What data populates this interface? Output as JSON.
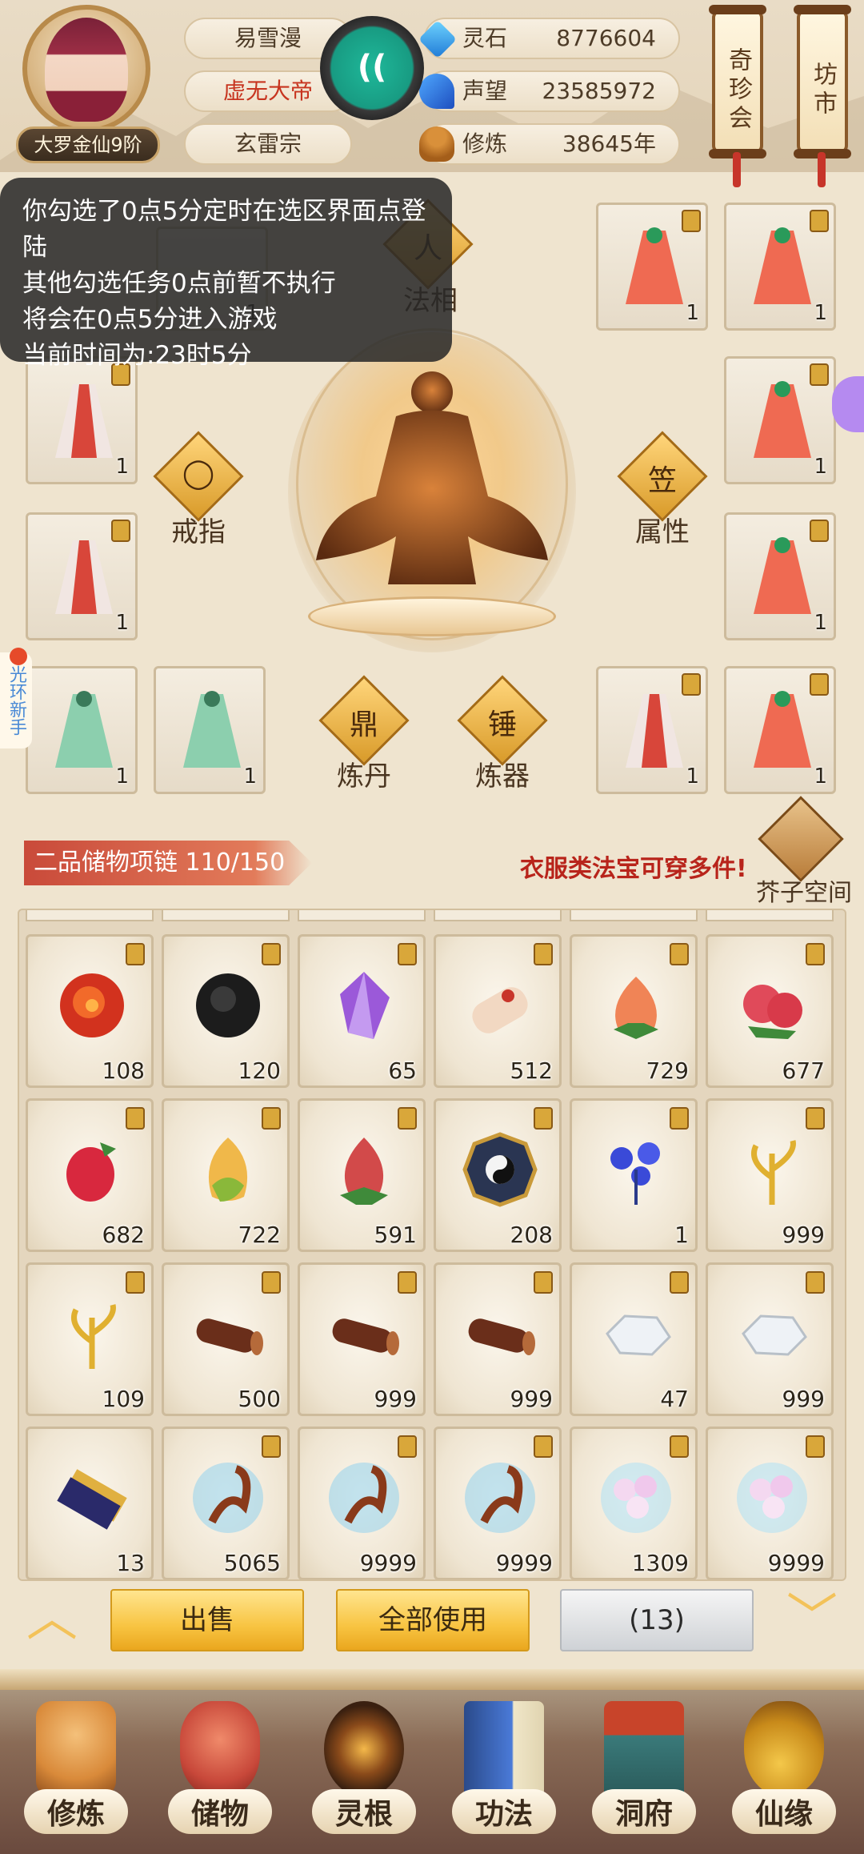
{
  "header": {
    "rank_label": "大罗金仙9阶",
    "name": "易雪漫",
    "title": "虚无大帝",
    "sect": "玄雷宗",
    "resources": [
      {
        "label": "灵石",
        "value": "8776604",
        "icon": "spirit-stone-icon"
      },
      {
        "label": "声望",
        "value": "23585972",
        "icon": "reputation-icon"
      },
      {
        "label": "修炼",
        "value": "38645年",
        "icon": "cultivation-icon"
      }
    ],
    "scroll_buttons": [
      {
        "label": "奇珍会"
      },
      {
        "label": "坊市"
      }
    ]
  },
  "notice": {
    "lines": [
      "你勾选了0点5分定时在选区界面点登陆",
      "其他勾选任务0点前暂不执行",
      "将会在0点5分进入游戏",
      "当前时间为:23时5分"
    ]
  },
  "equipment": {
    "slot_buttons": [
      {
        "label": "法相",
        "glyph": "人"
      },
      {
        "label": "戒指",
        "glyph": "◯"
      },
      {
        "label": "属性",
        "glyph": "笠"
      },
      {
        "label": "炼丹",
        "glyph": "鼎"
      },
      {
        "label": "炼器",
        "glyph": "锤"
      }
    ],
    "slots": [
      {
        "count": "1",
        "robe": "red"
      },
      {
        "count": "1",
        "robe": "red"
      },
      {
        "count": "1",
        "robe": "red"
      },
      {
        "count": "1",
        "robe": "white-red"
      },
      {
        "count": "1",
        "robe": "red"
      },
      {
        "count": "1",
        "robe": "white-red"
      },
      {
        "count": "1",
        "robe": "red"
      },
      {
        "count": "1",
        "robe": "green"
      },
      {
        "count": "1",
        "robe": "green"
      },
      {
        "count": "1",
        "robe": "white-red"
      },
      {
        "count": "1",
        "robe": "red"
      }
    ],
    "hidden_slot_count": "1",
    "side_tab": "光环新手"
  },
  "storage": {
    "title": "二品储物项链 110/150",
    "tip": "衣服类法宝可穿多件!",
    "mustard_label": "芥子空间"
  },
  "items": [
    {
      "qty": "108",
      "art": "red-orb-icon"
    },
    {
      "qty": "120",
      "art": "black-orb-icon"
    },
    {
      "qty": "65",
      "art": "purple-crystal-icon"
    },
    {
      "qty": "512",
      "art": "scroll-icon"
    },
    {
      "qty": "729",
      "art": "peach-icon"
    },
    {
      "qty": "677",
      "art": "berries-icon"
    },
    {
      "qty": "682",
      "art": "raspberry-icon"
    },
    {
      "qty": "722",
      "art": "lotus-fruit-icon"
    },
    {
      "qty": "591",
      "art": "red-bulb-icon"
    },
    {
      "qty": "208",
      "art": "bagua-compass-icon"
    },
    {
      "qty": "1",
      "art": "blue-flower-icon"
    },
    {
      "qty": "999",
      "art": "golden-herb-icon"
    },
    {
      "qty": "109",
      "art": "golden-herb-icon"
    },
    {
      "qty": "500",
      "art": "wood-log-icon"
    },
    {
      "qty": "999",
      "art": "wood-log-icon"
    },
    {
      "qty": "999",
      "art": "wood-log-icon"
    },
    {
      "qty": "47",
      "art": "white-ore-icon"
    },
    {
      "qty": "999",
      "art": "white-ore-icon"
    },
    {
      "qty": "13",
      "art": "talisman-icon"
    },
    {
      "qty": "5065",
      "art": "scorpion-icon"
    },
    {
      "qty": "9999",
      "art": "scorpion-icon"
    },
    {
      "qty": "9999",
      "art": "scorpion-icon"
    },
    {
      "qty": "1309",
      "art": "lily-icon"
    },
    {
      "qty": "9999",
      "art": "lily-icon"
    }
  ],
  "actions": {
    "sell": "出售",
    "use_all": "全部使用",
    "selected": "(13)"
  },
  "nav": [
    {
      "label": "修炼",
      "icon": "cultivate-nav-icon",
      "color": "#d98a3a"
    },
    {
      "label": "储物",
      "icon": "storage-bag-icon",
      "color": "#c8483a"
    },
    {
      "label": "灵根",
      "icon": "spirit-root-icon",
      "color": "#8a4a1a"
    },
    {
      "label": "功法",
      "icon": "skill-book-icon",
      "color": "#3a6ab8"
    },
    {
      "label": "洞府",
      "icon": "cave-house-icon",
      "color": "#b8442a"
    },
    {
      "label": "仙缘",
      "icon": "gourd-icon",
      "color": "#d8a23a"
    }
  ]
}
